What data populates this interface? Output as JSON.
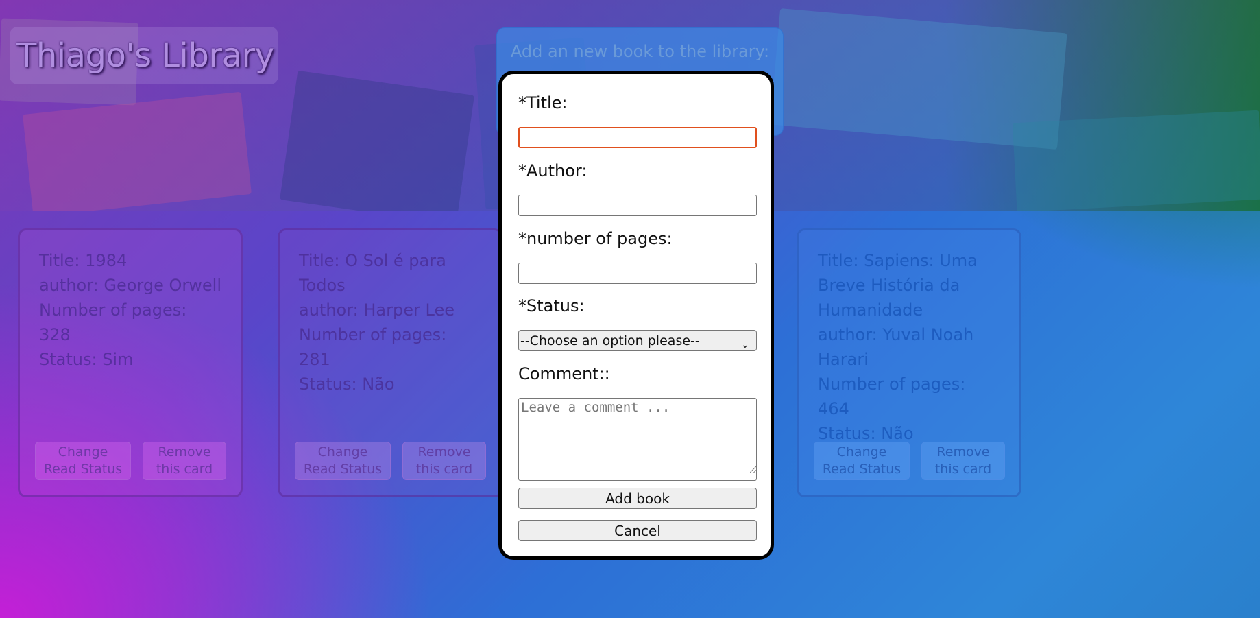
{
  "header": {
    "title": "Thiago's Library",
    "add_new_label": "Add an new book to the library:"
  },
  "cards": [
    {
      "title": "Title: 1984",
      "author": "author: George Orwell",
      "pages": "Number of pages: 328",
      "status": "Status: Sim",
      "change_label": "Change Read Status",
      "remove_label": "Remove this card"
    },
    {
      "title": "Title: O Sol é para Todos",
      "author": "author: Harper Lee",
      "pages": "Number of pages: 281",
      "status": "Status: Não",
      "change_label": "Change Read Status",
      "remove_label": "Remove this card"
    },
    {
      "title": "Title: Sapiens: Uma Breve História da Humanidade",
      "author": "author: Yuval Noah Harari",
      "pages": "Number of pages: 464",
      "status": "Status: Não",
      "change_label": "Change Read Status",
      "remove_label": "Remove this card"
    }
  ],
  "form": {
    "title_label": "*Title:",
    "title_value": "",
    "author_label": "*Author:",
    "author_value": "",
    "pages_label": "*number of pages:",
    "pages_value": "",
    "status_label": "*Status:",
    "status_selected": "--Choose an option please--",
    "comment_label": "Comment::",
    "comment_placeholder": "Leave a comment ...",
    "add_button": "Add book",
    "cancel_button": "Cancel"
  },
  "colors": {
    "focus_border": "#e0501e",
    "modal_border": "#000000"
  },
  "icons": {
    "select_arrow": "chevron-down-icon",
    "resize": "resize-grip-icon"
  }
}
